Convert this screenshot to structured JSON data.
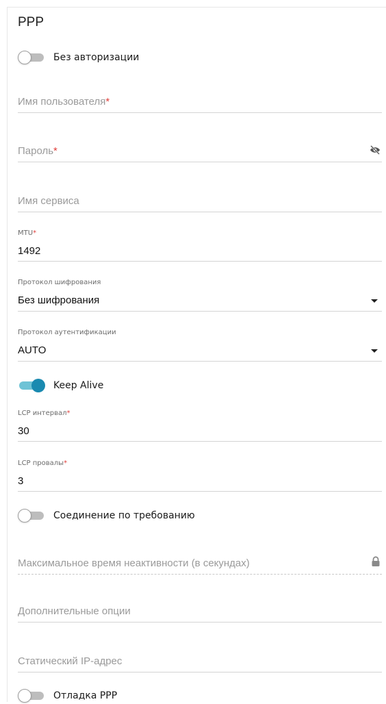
{
  "section": {
    "title": "PPP"
  },
  "no_auth": {
    "label": "Без авторизации",
    "on": false
  },
  "username": {
    "placeholder": "Имя пользователя",
    "required_mark": "*",
    "value": ""
  },
  "password": {
    "placeholder": "Пароль",
    "required_mark": "*",
    "value": "",
    "icon": "eye-slash-icon"
  },
  "service_name": {
    "placeholder": "Имя сервиса",
    "value": ""
  },
  "mtu": {
    "label": "MTU",
    "required_mark": "*",
    "value": "1492"
  },
  "encryption": {
    "label": "Протокол шифрования",
    "value": "Без шифрования",
    "icon": "caret-down-icon"
  },
  "auth_protocol": {
    "label": "Протокол аутентификации",
    "value": "AUTO",
    "icon": "caret-down-icon"
  },
  "keep_alive": {
    "label": "Keep Alive",
    "on": true
  },
  "lcp_interval": {
    "label": "LCP интервал",
    "required_mark": "*",
    "value": "30"
  },
  "lcp_failures": {
    "label": "LCP провалы",
    "required_mark": "*",
    "value": "3"
  },
  "on_demand": {
    "label": "Соединение по требованию",
    "on": false
  },
  "idle_time": {
    "placeholder": "Максимальное время неактивности (в секундах)",
    "disabled": true,
    "icon": "lock-icon"
  },
  "extra_options": {
    "placeholder": "Дополнительные опции",
    "value": ""
  },
  "static_ip": {
    "placeholder": "Статический IP-адрес",
    "value": ""
  },
  "ppp_debug": {
    "label": "Отладка PPP",
    "on": false
  },
  "colors": {
    "accent": "#1a8ab0",
    "accent_track": "#6ec3d6",
    "required": "#e0403c",
    "placeholder": "#9a9a9a",
    "line": "#d4d4d4"
  }
}
